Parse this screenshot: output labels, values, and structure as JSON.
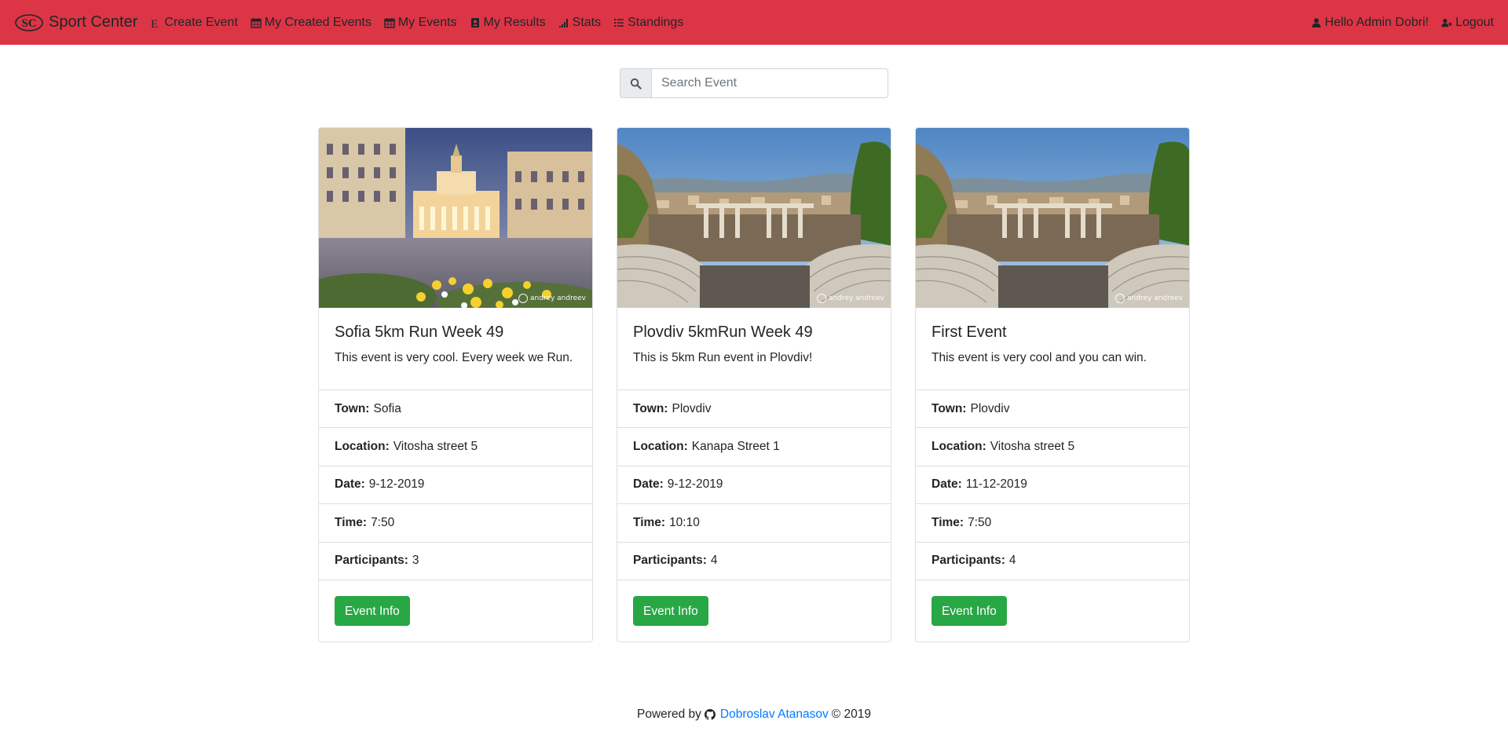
{
  "brand": {
    "logo_text": "SC",
    "name": "Sport Center"
  },
  "nav": {
    "left": [
      {
        "label": "Create Event",
        "icon": "e-letter-icon"
      },
      {
        "label": "My Created Events",
        "icon": "calendar-icon"
      },
      {
        "label": "My Events",
        "icon": "calendar-icon"
      },
      {
        "label": "My Results",
        "icon": "contact-card-icon"
      },
      {
        "label": "Stats",
        "icon": "signal-bars-icon"
      },
      {
        "label": "Standings",
        "icon": "list-icon"
      }
    ],
    "right": [
      {
        "label": "Hello Admin Dobri!",
        "icon": "user-icon"
      },
      {
        "label": "Logout",
        "icon": "user-times-icon"
      }
    ]
  },
  "search": {
    "placeholder": "Search Event",
    "value": ""
  },
  "labels": {
    "town": "Town:",
    "location": "Location:",
    "date": "Date:",
    "time": "Time:",
    "participants": "Participants:",
    "button": "Event Info"
  },
  "events": [
    {
      "title": "Sofia 5km Run Week 49",
      "description": "This event is very cool. Every week we Run.",
      "town": "Sofia",
      "location": "Vitosha street 5",
      "date": "9-12-2019",
      "time": "7:50",
      "participants": "3",
      "image": "sofia-square-photo",
      "watermark": "andrey andreev"
    },
    {
      "title": "Plovdiv 5kmRun Week 49",
      "description": "This is 5km Run event in Plovdiv!",
      "town": "Plovdiv",
      "location": "Kanapa Street 1",
      "date": "9-12-2019",
      "time": "10:10",
      "participants": "4",
      "image": "plovdiv-theatre-photo",
      "watermark": "andrey andreev"
    },
    {
      "title": "First Event",
      "description": "This event is very cool and you can win.",
      "town": "Plovdiv",
      "location": "Vitosha street 5",
      "date": "11-12-2019",
      "time": "7:50",
      "participants": "4",
      "image": "plovdiv-theatre-photo",
      "watermark": "andrey andreev"
    }
  ],
  "footer": {
    "prefix": "Powered by",
    "author": "Dobroslav Atanasov",
    "suffix": "© 2019",
    "icon": "github-icon"
  },
  "colors": {
    "navbar": "#dc3545",
    "button": "#28a745",
    "link": "#007bff"
  }
}
